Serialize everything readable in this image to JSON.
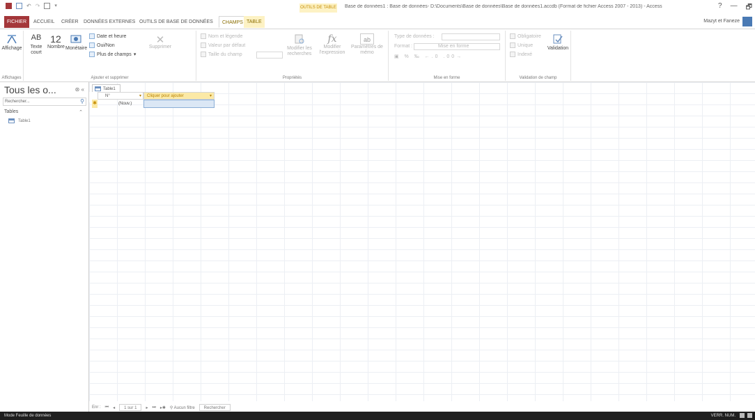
{
  "titlebar": {
    "context_header": "OUTILS DE TABLE",
    "title": "Base de données1 : Base de données- D:\\Documents\\Base de données\\Base de données1.accdb (Format de fichier Access 2007 - 2013) - Access",
    "help": "?",
    "minimize": "—",
    "restore": "🗗"
  },
  "tabs": {
    "file": "FICHIER",
    "home": "ACCUEIL",
    "create": "CRÉER",
    "external": "DONNÉES EXTERNES",
    "dbtools": "OUTILS DE BASE DE DONNÉES",
    "fields": "CHAMPS",
    "table": "TABLE"
  },
  "account": "Mazyt et Faneze",
  "ribbon": {
    "views": {
      "label": "Affichage",
      "group": "Affichages"
    },
    "add_delete": {
      "text_short": "Texte court",
      "text_icon": "AB",
      "number": "Nombre",
      "number_icon": "12",
      "currency": "Monétaire",
      "datetime": "Date et heure",
      "yesno": "Oui/Non",
      "more_fields": "Plus de champs",
      "delete": "Supprimer",
      "group": "Ajouter et supprimer"
    },
    "properties": {
      "name_caption": "Nom et légende",
      "default_value": "Valeur par défaut",
      "field_size": "Taille du champ",
      "modify_lookups": "Modifier les recherches",
      "modify_expression": "Modifier l'expression",
      "memo_settings": "Paramètres de mémo",
      "group": "Propriétés"
    },
    "formatting": {
      "data_type": "Type de données :",
      "format": "Format :",
      "format_value": "Mise en forme",
      "group": "Mise en forme"
    },
    "validation": {
      "required": "Obligatoire",
      "unique": "Unique",
      "indexed": "Indexé",
      "validation": "Validation",
      "group": "Validation de champ"
    }
  },
  "nav": {
    "title": "Tous les o...",
    "search_placeholder": "Rechercher...",
    "group": "Tables",
    "items": [
      {
        "label": "Table1"
      }
    ]
  },
  "document": {
    "tab": "Table1",
    "columns": {
      "id": "N°",
      "click_to_add": "Cliquer pour ajouter"
    },
    "new_row": "(Nouv.)"
  },
  "record_nav": {
    "prefix": "Enr :",
    "position": "1 sur 1",
    "filter": "Aucun filtre",
    "search": "Rechercher"
  },
  "status": {
    "mode": "Mode Feuille de données",
    "numlock": "VERR. NUM."
  }
}
